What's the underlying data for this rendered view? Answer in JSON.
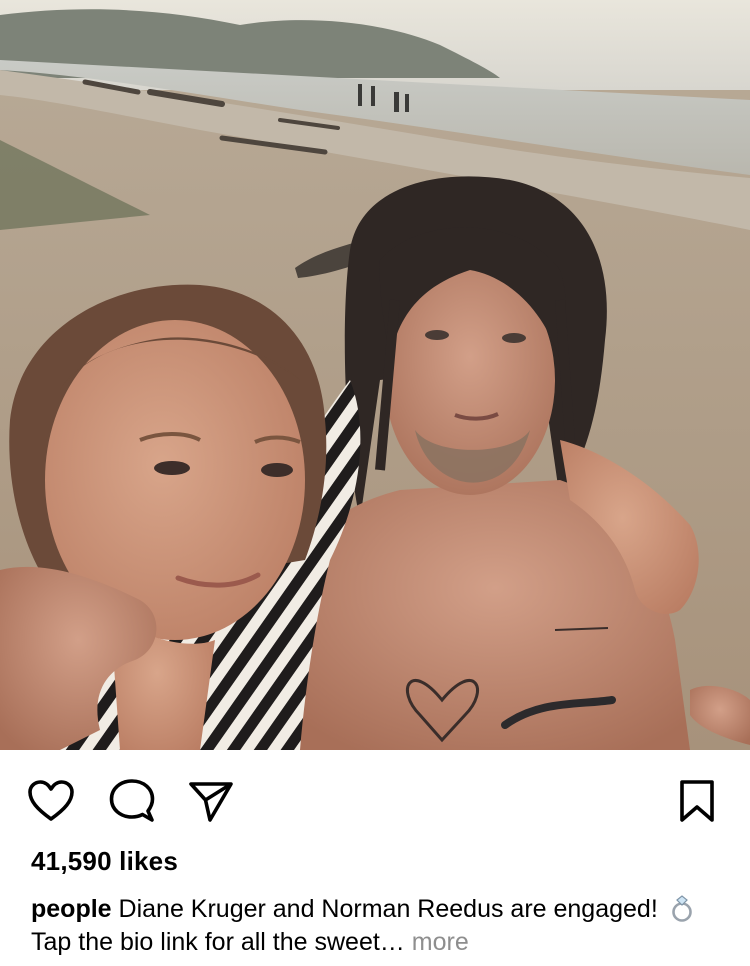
{
  "post": {
    "image_alt": "Selfie of two people on a beach at dusk",
    "likes_label": "41,590 likes",
    "caption": {
      "username": "people",
      "text_part1": "Diane Kruger and Norman Reedus are engaged!",
      "emoji_name": "ring-emoji",
      "text_part2": "Tap the bio link for all the sweet…",
      "more_label": "more"
    }
  },
  "actions": {
    "like_icon": "heart-icon",
    "comment_icon": "comment-icon",
    "share_icon": "paper-plane-icon",
    "save_icon": "bookmark-icon"
  },
  "colors": {
    "text": "#000000",
    "muted": "#8e8e8e",
    "background": "#ffffff"
  }
}
